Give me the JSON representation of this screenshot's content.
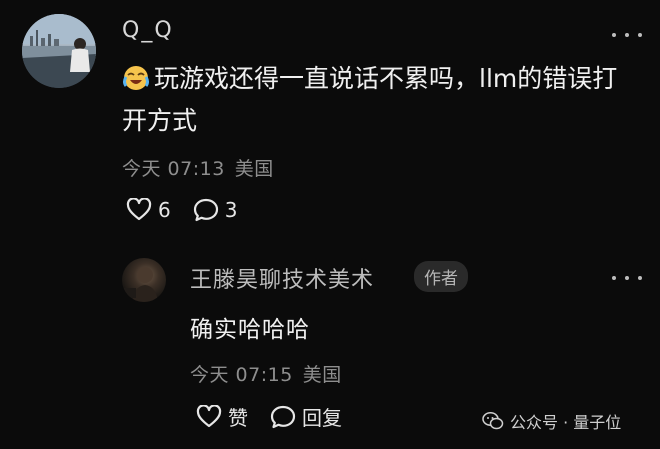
{
  "comment": {
    "username": "Q_Q",
    "emoji_icon": "crying-laughing-face-icon",
    "text": "玩游戏还得一直说话不累吗，llm的错误打开方式",
    "time": "今天 07:13",
    "location": "美国",
    "likes": "6",
    "replies": "3"
  },
  "reply": {
    "username": "王滕昊聊技术美术",
    "badge": "作者",
    "text": "确实哈哈哈",
    "time": "今天 07:15",
    "location": "美国",
    "like_label": "赞",
    "reply_label": "回复"
  },
  "watermark": {
    "text": "公众号 · 量子位"
  }
}
